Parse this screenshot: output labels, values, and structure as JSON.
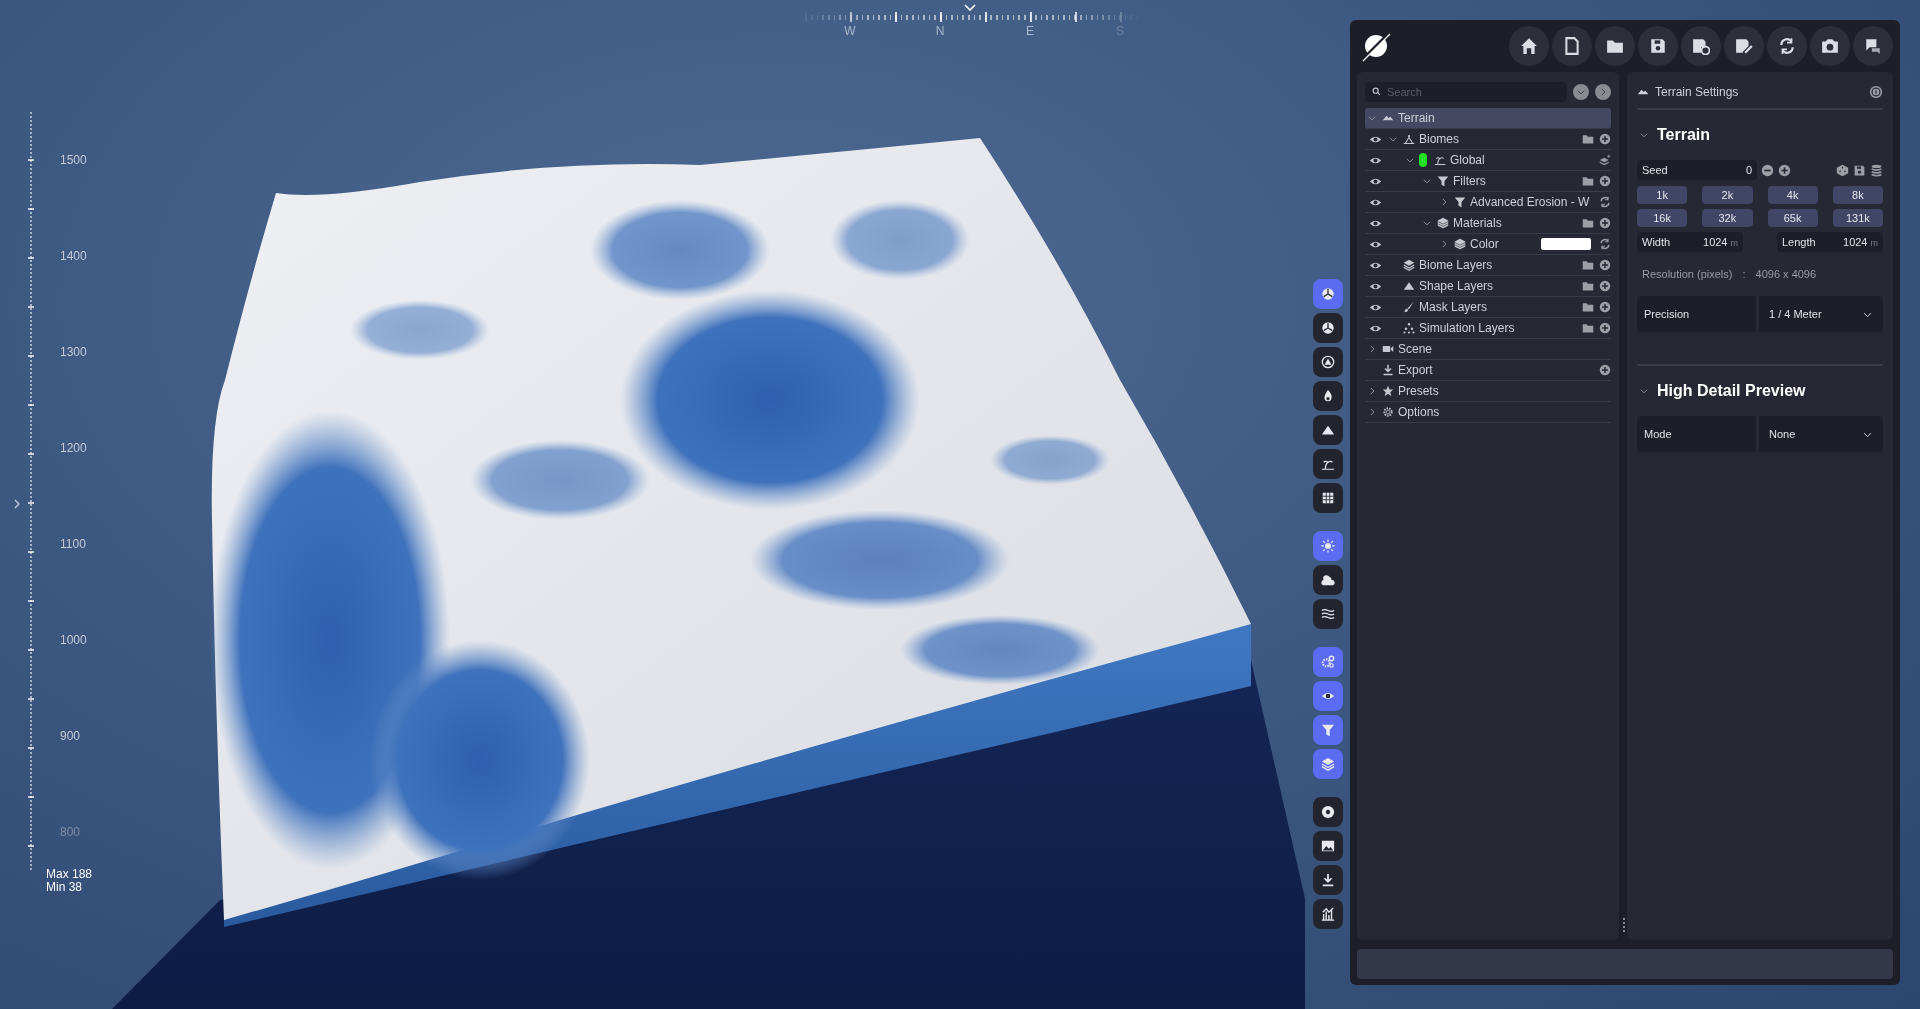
{
  "viewport": {
    "compass": [
      "W",
      "N",
      "E",
      "S"
    ],
    "ruler": [
      "1500",
      "1400",
      "1300",
      "1200",
      "1100",
      "1000",
      "900",
      "800"
    ],
    "max": "Max 188",
    "min": "Min 38"
  },
  "toolbar": [
    [
      {
        "selected": true
      },
      {
        "selected": false
      },
      {
        "selected": false
      },
      {
        "selected": false
      },
      {
        "selected": false
      },
      {
        "selected": false
      },
      {
        "selected": false
      }
    ],
    [
      {
        "selected": true
      },
      {
        "selected": false
      },
      {
        "selected": false
      }
    ],
    [
      {
        "selected": true
      },
      {
        "selected": true
      },
      {
        "selected": true
      },
      {
        "selected": true
      }
    ],
    [
      {
        "selected": false
      },
      {
        "selected": false
      },
      {
        "selected": false
      },
      {
        "selected": false
      }
    ]
  ],
  "search": {
    "placeholder": "Search"
  },
  "tree": [
    {
      "label": "Terrain",
      "kind": "terrain",
      "expanded": true,
      "selected": true,
      "children": [
        {
          "label": "Biomes",
          "kind": "biomes",
          "visible": true,
          "expanded": true,
          "selected": false,
          "children": [
            {
              "label": "Global",
              "kind": "biome",
              "visible": true,
              "expanded": true,
              "selected": false,
              "color": "#22e022",
              "children": [
                {
                  "label": "Filters",
                  "kind": "filters",
                  "visible": true,
                  "expanded": true,
                  "selected": false,
                  "children": [
                    {
                      "label": "Advanced Erosion - W",
                      "kind": "filter",
                      "visible": true,
                      "expanded": false,
                      "selected": false
                    }
                  ]
                },
                {
                  "label": "Materials",
                  "kind": "materials",
                  "visible": true,
                  "expanded": true,
                  "selected": false,
                  "children": [
                    {
                      "label": "Color",
                      "kind": "material",
                      "visible": true,
                      "expanded": false,
                      "selected": false,
                      "color": "#ffffff"
                    }
                  ]
                }
              ]
            }
          ]
        },
        {
          "label": "Biome Layers",
          "kind": "biome_layers",
          "visible": true,
          "selected": false
        },
        {
          "label": "Shape Layers",
          "kind": "shape_layers",
          "visible": true,
          "selected": false
        },
        {
          "label": "Mask Layers",
          "kind": "mask_layers",
          "visible": true,
          "selected": false
        },
        {
          "label": "Simulation Layers",
          "kind": "simulation_layers",
          "visible": true,
          "selected": false
        }
      ]
    },
    {
      "label": "Scene",
      "kind": "scene",
      "expanded": false,
      "selected": false
    },
    {
      "label": "Export",
      "kind": "export",
      "selected": false
    },
    {
      "label": "Presets",
      "kind": "presets",
      "expanded": false,
      "selected": false
    },
    {
      "label": "Options",
      "kind": "options",
      "expanded": false,
      "selected": false
    }
  ],
  "settings": {
    "title": "Terrain Settings",
    "terrain_section": {
      "title": "Terrain",
      "expanded": true,
      "seed": {
        "label": "Seed",
        "value": "0"
      },
      "sizes": [
        "1k",
        "2k",
        "4k",
        "8k",
        "16k",
        "32k",
        "65k",
        "131k"
      ],
      "width": {
        "label": "Width",
        "value": "1024",
        "unit": "m"
      },
      "length": {
        "label": "Length",
        "value": "1024",
        "unit": "m"
      },
      "resolution": {
        "label": "Resolution (pixels)",
        "separator": ":",
        "value": "4096 x 4096"
      },
      "precision": {
        "label": "Precision",
        "value": "1 / 4 Meter"
      }
    },
    "preview_section": {
      "title": "High Detail Preview",
      "expanded": true,
      "mode": {
        "label": "Mode",
        "value": "None"
      }
    }
  }
}
